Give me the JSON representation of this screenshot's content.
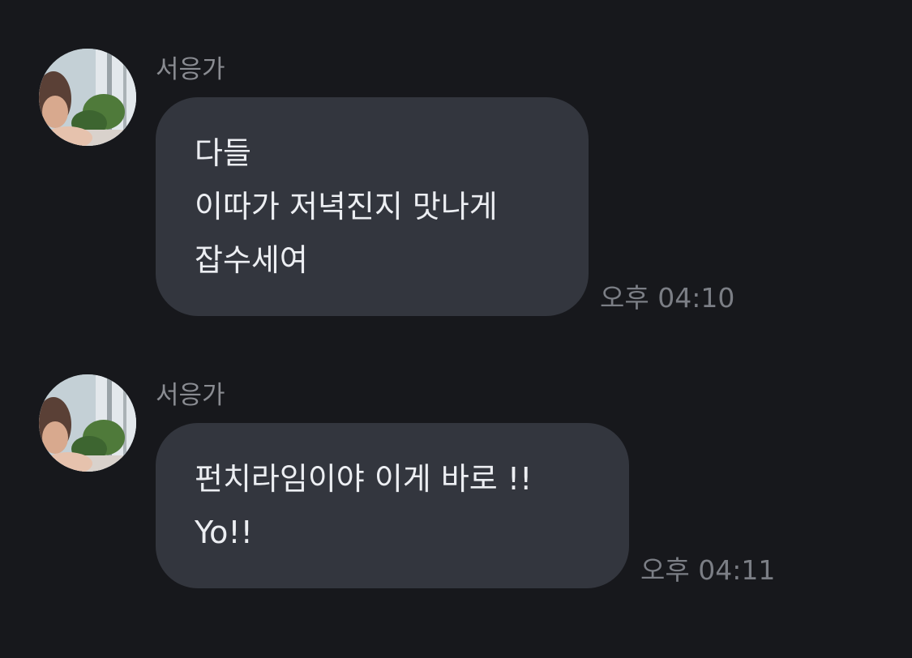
{
  "messages": [
    {
      "sender": "서응가",
      "lines": [
        "다들",
        "이따가 저녁진지 맛나게",
        "잡수세여"
      ],
      "time": "오후 04:10"
    },
    {
      "sender": "서응가",
      "lines": [
        "펀치라임이야 이게 바로 !!",
        "Yo!!"
      ],
      "time": "오후 04:11"
    }
  ],
  "colors": {
    "background": "#17181c",
    "bubble": "#33363e",
    "bubble_text": "#eceef2",
    "meta_text": "#8a8c92"
  }
}
